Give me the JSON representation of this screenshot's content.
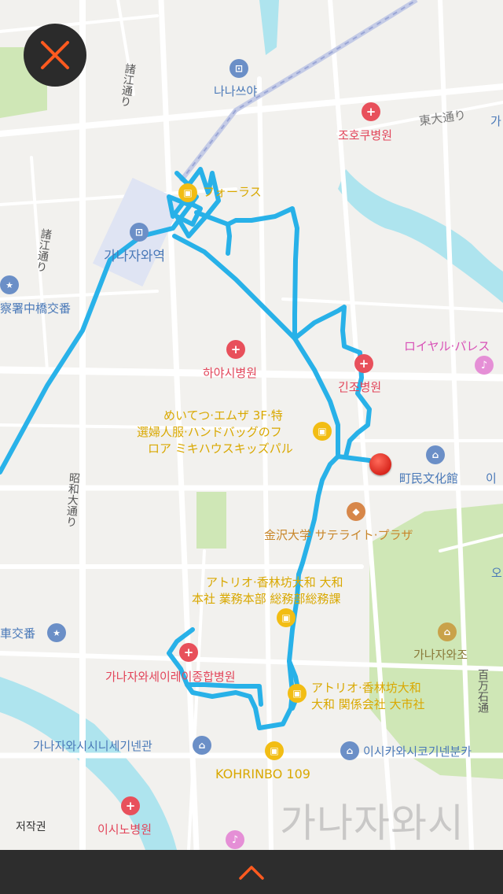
{
  "map": {
    "city_watermark": "가나자와시",
    "copyright": "저작권",
    "route_color": "#1eaee8",
    "labels": {
      "nanasuya": "나나쓰야",
      "jochu_hospital": "조호쿠병원",
      "higashi_odori": "東大通り",
      "forus": "フォーラス",
      "kanazawa_station": "가나자와역",
      "shoe_dori_1": "諸江通り",
      "shoe_dori_2": "諸江通り",
      "police_box": "察署中橋交番",
      "hayashi_hospital": "하야시병원",
      "royal_place": "ロイヤル·パレス",
      "kinjo_hospital": "긴조병원",
      "meitetsu_1": "めいてつ·エムザ 3F·特",
      "meitetsu_2": "選婦人服·ハンドバッグのフ",
      "meitetsu_3": "ロア ミキハウスキッズパル",
      "chomin_bunkakan": "町民文化館",
      "chomin_suffix": "이",
      "showa_odori": "昭和大通り",
      "univ_satellite": "金沢大学 サテライト·プラザ",
      "atorio_1": "アトリオ·香林坊大和 大和",
      "atorio_2": "本社 業務本部 総務部総務課",
      "koban_left": "車交番",
      "kanazawa_castle": "가나자와조",
      "hyakumangoku": "百万石通",
      "seirei_hospital": "가나자와세이레이종합병원",
      "atorio_3": "アトリオ·香林坊大和",
      "atorio_4": "大和 関係会社 大市社",
      "shinise_kinenkan": "가나자와시시니세기넨관",
      "ishikawa_kinen": "이시카와시코기넨분카",
      "kohrinbo": "KOHRINBO 109",
      "ishino_hospital": "이시노병원",
      "right_cut_1": "가",
      "right_cut_2": "오"
    }
  },
  "close_button": {
    "icon": "close-icon",
    "color": "#ff5a1f"
  },
  "bottom_bar": {
    "icon": "chevron-up-icon",
    "color": "#ff5a1f"
  }
}
